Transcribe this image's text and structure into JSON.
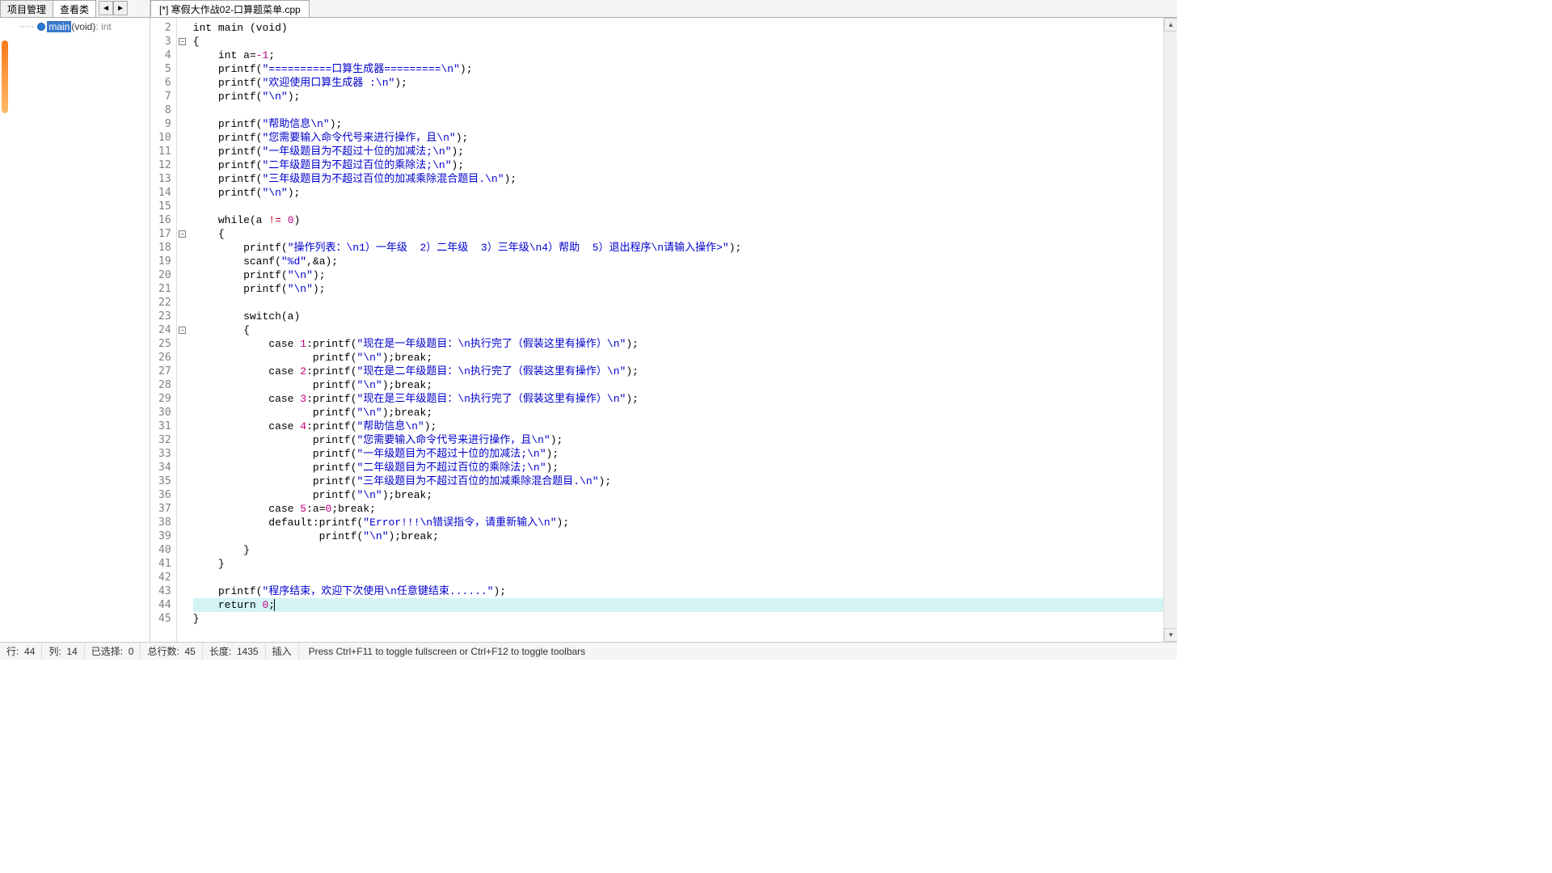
{
  "left_tabs": {
    "project": "项目管理",
    "classes": "查看类"
  },
  "nav": {
    "prev": "◄",
    "next": "►"
  },
  "tree": {
    "dots": "·····",
    "main": "main",
    "sig": "(void)",
    "ret": " : int"
  },
  "file_tab": "[*] 寒假大作战02-口算题菜单.cpp",
  "lines": {
    "start": 2,
    "end": 45,
    "folds": {
      "3": "-",
      "17": "-",
      "24": "-"
    }
  },
  "code": {
    "l2": {
      "t": "int main (void)"
    },
    "l3": {
      "t": "{"
    },
    "l4": {
      "p": "    ",
      "a": "int a=",
      "n": "-1",
      "e": ";"
    },
    "l5": {
      "p": "    printf(",
      "s": "\"==========口算生成器=========\\n\"",
      "e": ");"
    },
    "l6": {
      "p": "    printf(",
      "s": "\"欢迎使用口算生成器 :\\n\"",
      "e": ");"
    },
    "l7": {
      "p": "    printf(",
      "s": "\"\\n\"",
      "e": ");"
    },
    "l8": {
      "t": ""
    },
    "l9": {
      "p": "    printf(",
      "s": "\"帮助信息\\n\"",
      "e": ");"
    },
    "l10": {
      "p": "    printf(",
      "s": "\"您需要输入命令代号来进行操作，且\\n\"",
      "e": ");"
    },
    "l11": {
      "p": "    printf(",
      "s": "\"一年级题目为不超过十位的加减法;\\n\"",
      "e": ");"
    },
    "l12": {
      "p": "    printf(",
      "s": "\"二年级题目为不超过百位的乘除法;\\n\"",
      "e": ");"
    },
    "l13": {
      "p": "    printf(",
      "s": "\"三年级题目为不超过百位的加减乘除混合题目.\\n\"",
      "e": ");"
    },
    "l14": {
      "p": "    printf(",
      "s": "\"\\n\"",
      "e": ");"
    },
    "l15": {
      "t": ""
    },
    "l16": {
      "p": "    ",
      "a": "while(a ",
      "o": "!=",
      "b": " ",
      "n": "0",
      "e": ")"
    },
    "l17": {
      "t": "    {"
    },
    "l18": {
      "p": "        printf(",
      "s": "\"操作列表：\\n1）一年级  2）二年级  3）三年级\\n4）帮助  5）退出程序\\n请输入操作>\"",
      "e": ");"
    },
    "l19": {
      "p": "        scanf(",
      "s": "\"%d\"",
      "e": ",&a);"
    },
    "l20": {
      "p": "        printf(",
      "s": "\"\\n\"",
      "e": ");"
    },
    "l21": {
      "p": "        printf(",
      "s": "\"\\n\"",
      "e": ");"
    },
    "l22": {
      "t": ""
    },
    "l23": {
      "t": "        switch(a)"
    },
    "l24": {
      "t": "        {"
    },
    "l25": {
      "p": "            case ",
      "n": "1",
      "m": ":printf(",
      "s": "\"现在是一年级题目：\\n执行完了（假装这里有操作）\\n\"",
      "e": ");"
    },
    "l26": {
      "p": "                   printf(",
      "s": "\"\\n\"",
      "e": ");break;"
    },
    "l27": {
      "p": "            case ",
      "n": "2",
      "m": ":printf(",
      "s": "\"现在是二年级题目：\\n执行完了（假装这里有操作）\\n\"",
      "e": ");"
    },
    "l28": {
      "p": "                   printf(",
      "s": "\"\\n\"",
      "e": ");break;"
    },
    "l29": {
      "p": "            case ",
      "n": "3",
      "m": ":printf(",
      "s": "\"现在是三年级题目：\\n执行完了（假装这里有操作）\\n\"",
      "e": ");"
    },
    "l30": {
      "p": "                   printf(",
      "s": "\"\\n\"",
      "e": ");break;"
    },
    "l31": {
      "p": "            case ",
      "n": "4",
      "m": ":printf(",
      "s": "\"帮助信息\\n\"",
      "e": ");"
    },
    "l32": {
      "p": "                   printf(",
      "s": "\"您需要输入命令代号来进行操作，且\\n\"",
      "e": ");"
    },
    "l33": {
      "p": "                   printf(",
      "s": "\"一年级题目为不超过十位的加减法;\\n\"",
      "e": ");"
    },
    "l34": {
      "p": "                   printf(",
      "s": "\"二年级题目为不超过百位的乘除法;\\n\"",
      "e": ");"
    },
    "l35": {
      "p": "                   printf(",
      "s": "\"三年级题目为不超过百位的加减乘除混合题目.\\n\"",
      "e": ");"
    },
    "l36": {
      "p": "                   printf(",
      "s": "\"\\n\"",
      "e": ");break;"
    },
    "l37": {
      "p": "            case ",
      "n": "5",
      "m": ":a=",
      "n2": "0",
      "e": ";break;"
    },
    "l38": {
      "p": "            default:printf(",
      "s": "\"Error!!!\\n错误指令，请重新输入\\n\"",
      "e": ");"
    },
    "l39": {
      "p": "                    printf(",
      "s": "\"\\n\"",
      "e": ");break;"
    },
    "l40": {
      "t": "        }"
    },
    "l41": {
      "t": "    }"
    },
    "l42": {
      "t": ""
    },
    "l43": {
      "p": "    printf(",
      "s": "\"程序结束，欢迎下次使用\\n任意键结束......\"",
      "e": ");"
    },
    "l44": {
      "p": "    return ",
      "n": "0",
      "e": ";",
      "cur": true
    },
    "l45": {
      "t": "}"
    }
  },
  "status": {
    "row_lbl": "行:",
    "row": "44",
    "col_lbl": "列:",
    "col": "14",
    "sel_lbl": "已选择:",
    "sel": "0",
    "total_lbl": "总行数:",
    "total": "45",
    "len_lbl": "长度:",
    "len": "1435",
    "mode": "插入",
    "hint": "Press Ctrl+F11 to toggle fullscreen or Ctrl+F12 to toggle toolbars"
  },
  "scroll": {
    "up": "▲",
    "down": "▼"
  }
}
